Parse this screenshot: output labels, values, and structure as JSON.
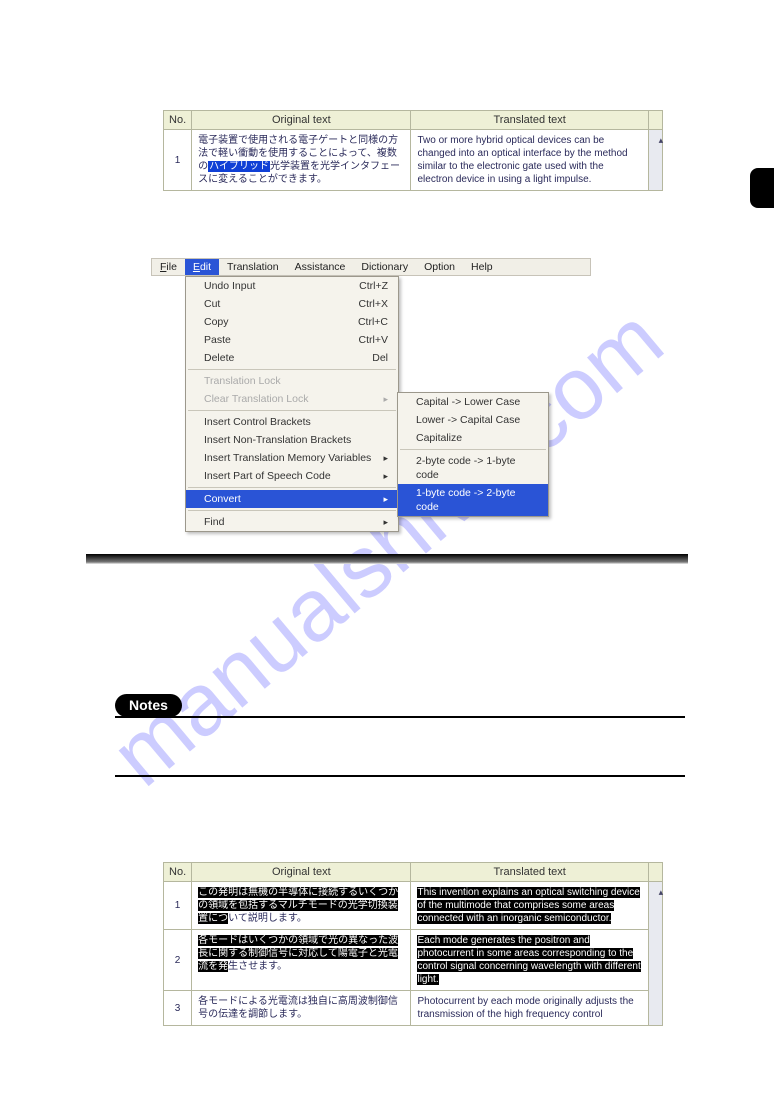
{
  "watermark": "manualshive.com",
  "table1": {
    "headers": {
      "no": "No.",
      "orig": "Original text",
      "trans": "Translated text"
    },
    "row": {
      "num": "1",
      "orig_pre": "電子装置で使用される電子ゲートと同様の方法で軽い衝動を使用することによって、複数の",
      "orig_hl": "ハイブリッド",
      "orig_post": "光学装置を光学インタフェースに変えることができます。",
      "trans": "Two or more hybrid optical devices can be changed into an optical interface by the method similar to the electronic gate used with the electron device in using a light impulse."
    }
  },
  "menubar": [
    "File",
    "Edit",
    "Translation",
    "Assistance",
    "Dictionary",
    "Option",
    "Help"
  ],
  "dropdown": {
    "g1": [
      {
        "label": "Undo Input",
        "accel": "Ctrl+Z"
      },
      {
        "label": "Cut",
        "accel": "Ctrl+X"
      },
      {
        "label": "Copy",
        "accel": "Ctrl+C"
      },
      {
        "label": "Paste",
        "accel": "Ctrl+V"
      },
      {
        "label": "Delete",
        "accel": "Del"
      }
    ],
    "g2": [
      {
        "label": "Translation Lock",
        "disabled": true
      },
      {
        "label": "Clear Translation Lock",
        "disabled": true,
        "arrow": true
      }
    ],
    "g3": [
      {
        "label": "Insert Control Brackets"
      },
      {
        "label": "Insert Non-Translation Brackets"
      },
      {
        "label": "Insert Translation Memory Variables",
        "arrow": true
      },
      {
        "label": "Insert Part of Speech Code",
        "arrow": true
      }
    ],
    "g4": [
      {
        "label": "Convert",
        "hilite": true,
        "arrow": true
      }
    ],
    "g5": [
      {
        "label": "Find",
        "arrow": true
      }
    ]
  },
  "submenu": {
    "g1": [
      {
        "label": "Capital -> Lower Case"
      },
      {
        "label": "Lower -> Capital Case"
      },
      {
        "label": "Capitalize"
      }
    ],
    "g2": [
      {
        "label": "2-byte code -> 1-byte code"
      },
      {
        "label": "1-byte code -> 2-byte code",
        "hilite": true
      }
    ]
  },
  "notes_label": "Notes",
  "table3": {
    "headers": {
      "no": "No.",
      "orig": "Original text",
      "trans": "Translated text"
    },
    "rows": [
      {
        "num": "1",
        "orig_hl": "この発明は無機の半導体に接続するいくつかの領域を包括するマルチモードの光学切換装置につ",
        "orig_rest": "いて説明します。",
        "trans_hl": "This invention explains an optical switching device of the multimode that comprises some areas connected with an inorganic semiconductor."
      },
      {
        "num": "2",
        "orig_hl": "各モードはいくつかの領域で光の異なった波長に関する制御信号に対応して陽電子と光電流を発",
        "orig_rest": "生させます。",
        "trans_hl": "Each mode generates the positron and photocurrent in some areas corresponding to the control signal concerning wavelength with different light."
      },
      {
        "num": "3",
        "orig": "各モードによる光電流は独自に高周波制御信号の伝達を調節します。",
        "trans": "Photocurrent by each mode originally adjusts the transmission of the high frequency control"
      }
    ]
  }
}
